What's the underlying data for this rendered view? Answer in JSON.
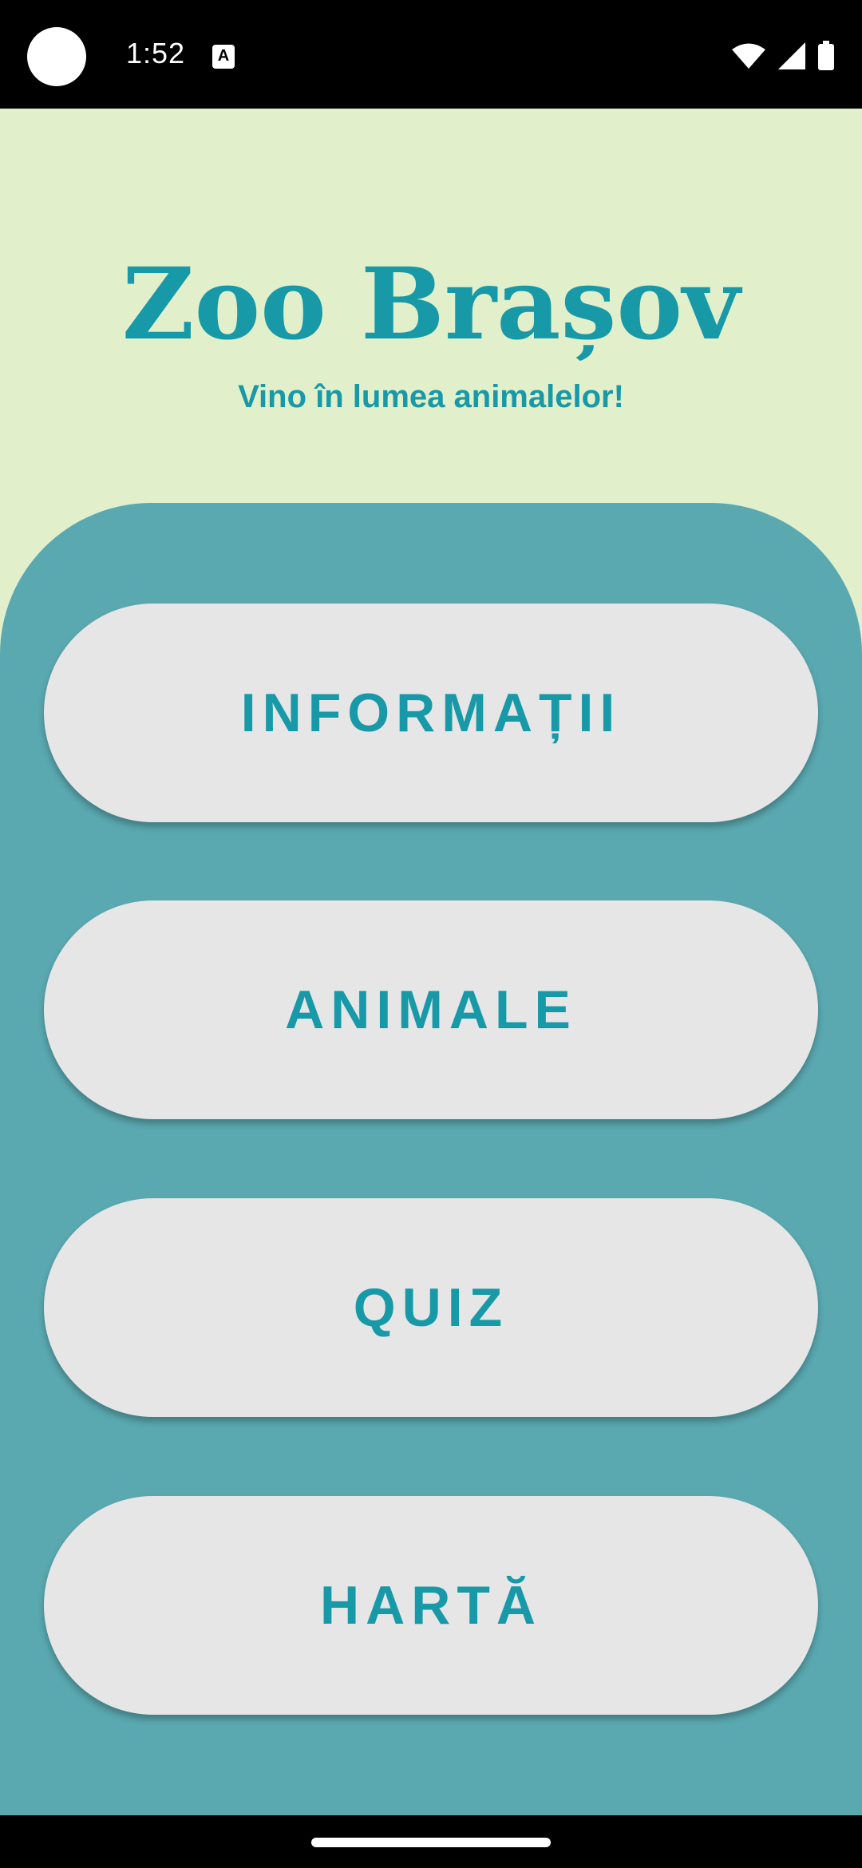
{
  "status_bar": {
    "time": "1:52",
    "notification_icon_letter": "A",
    "icons": [
      "wifi-icon",
      "signal-icon",
      "battery-icon"
    ]
  },
  "header": {
    "title": "Zoo Brașov",
    "subtitle": "Vino în lumea animalelor!"
  },
  "menu": {
    "buttons": [
      {
        "label": "INFORMAȚII"
      },
      {
        "label": "ANIMALE"
      },
      {
        "label": "QUIZ"
      },
      {
        "label": "HARTĂ"
      }
    ]
  },
  "colors": {
    "background": "#e1efcb",
    "panel": "#5aa8b0",
    "accent_text": "#1799a8",
    "button_bg": "#e6e6e6"
  }
}
